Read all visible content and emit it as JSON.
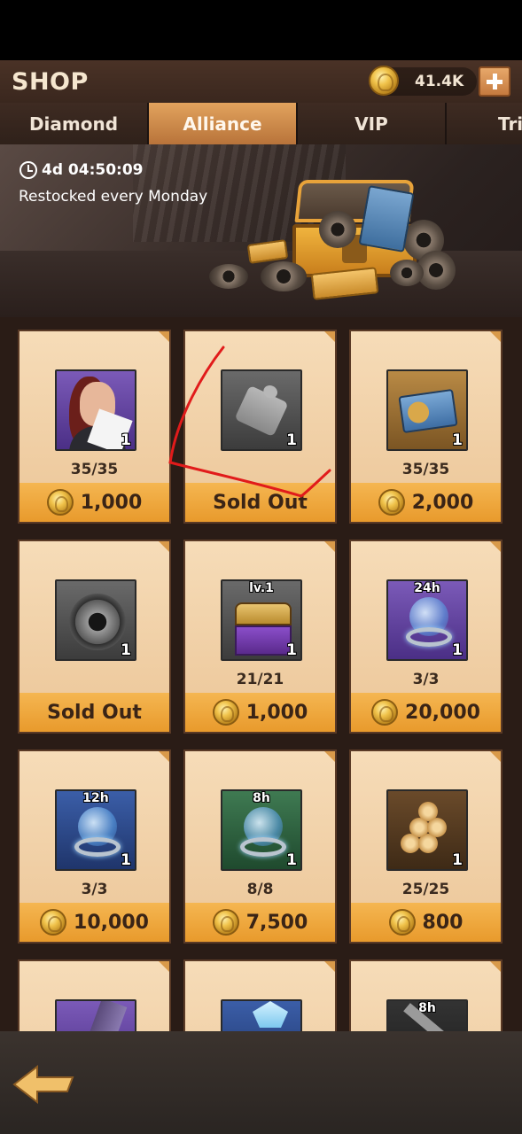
{
  "header": {
    "title": "SHOP",
    "currency_value": "41.4K"
  },
  "tabs": [
    {
      "label": "Diamond",
      "active": false
    },
    {
      "label": "Alliance",
      "active": true
    },
    {
      "label": "VIP",
      "active": false
    },
    {
      "label": "Tri",
      "active": false
    }
  ],
  "banner": {
    "timer": "4d 04:50:09",
    "restock_note": "Restocked every Monday"
  },
  "items": [
    {
      "icon": "hero-fragment-icon",
      "qty": "1",
      "stock": "35/35",
      "price": "1,000",
      "sold_out": false
    },
    {
      "icon": "puzzle-fragment-icon",
      "qty": "1",
      "stock": "",
      "price": "Sold Out",
      "sold_out": true
    },
    {
      "icon": "ticket-icon",
      "qty": "1",
      "stock": "35/35",
      "price": "2,000",
      "sold_out": false
    },
    {
      "icon": "saw-gear-icon",
      "qty": "1",
      "stock": "",
      "price": "Sold Out",
      "sold_out": true
    },
    {
      "icon": "level-chest-icon",
      "tag": "lv.1",
      "qty": "1",
      "stock": "21/21",
      "price": "1,000",
      "sold_out": false
    },
    {
      "icon": "speedup-24h-icon",
      "tag": "24h",
      "qty": "1",
      "stock": "3/3",
      "price": "20,000",
      "sold_out": false
    },
    {
      "icon": "speedup-12h-icon",
      "tag": "12h",
      "qty": "1",
      "stock": "3/3",
      "price": "10,000",
      "sold_out": false
    },
    {
      "icon": "speedup-8h-icon",
      "tag": "8h",
      "qty": "1",
      "stock": "8/8",
      "price": "7,500",
      "sold_out": false
    },
    {
      "icon": "wood-logs-icon",
      "qty": "1",
      "stock": "25/25",
      "price": "800",
      "sold_out": false
    },
    {
      "icon": "cannon-icon"
    },
    {
      "icon": "crystal-icon"
    },
    {
      "icon": "hammer-icon",
      "tag": "8h"
    }
  ],
  "colors": {
    "accent_tab": "#e2a35d",
    "price_bar": "#f5b651",
    "card": "#f6dcb8",
    "annotation": "#e11b1b"
  }
}
